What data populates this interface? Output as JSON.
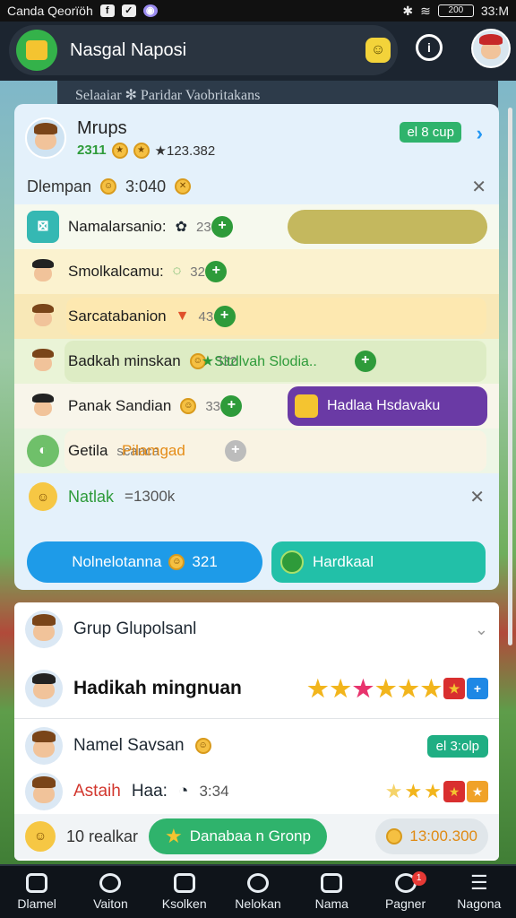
{
  "status": {
    "carrier": "Canda Qeorïöh",
    "time": "33:M",
    "battery": "200"
  },
  "header": {
    "title": "Nasgal Naposi",
    "info_icon": "info-icon"
  },
  "background_strip": "Selaaiar ✻ Paridar Vaobritakans",
  "card1": {
    "name": "Mrups",
    "level": "2311",
    "score": "★123.382",
    "pill": "el 8 cup",
    "section": {
      "label": "Dlempan",
      "value": "3:040"
    },
    "rows": [
      {
        "label": "Namalarsanio:",
        "value": "233"
      },
      {
        "label": "Smolkalcamu:",
        "value": "323"
      },
      {
        "label": "Sarcatabanion",
        "value": "436"
      },
      {
        "label": "Badkah minskan",
        "value": "332",
        "extra": "★Sitdlvah Slodia.."
      },
      {
        "label": "Panak Sandian",
        "value": "338",
        "button": "Hadlaa Hsdavaku"
      },
      {
        "label": "Getila",
        "sub": "scanca",
        "extra": "Pilamgad"
      }
    ],
    "notice": {
      "label": "Natlak",
      "value": "=1300k"
    },
    "btn_blue": {
      "label": "Nolnelotanna",
      "value": "321"
    },
    "btn_teal": {
      "label": "Hardkaal"
    }
  },
  "card2": {
    "group": "Grup Glupolsanl",
    "title": "Hadikah mingnuan",
    "name_row": {
      "label": "Namel Savsan",
      "pill": "el 3:olp"
    },
    "ast_row": {
      "label": "Astaih",
      "label2": "Haa:",
      "value": "3:34"
    },
    "bottom": {
      "count": "10 realkar",
      "button": "Danabaa n Gronp",
      "score": "13:00.300"
    }
  },
  "nav": [
    {
      "label": "Dlamel"
    },
    {
      "label": "Vaiton"
    },
    {
      "label": "Ksolken"
    },
    {
      "label": "Nelokan"
    },
    {
      "label": "Nama"
    },
    {
      "label": "Pagner",
      "badge": "1"
    },
    {
      "label": "Nagona"
    }
  ]
}
